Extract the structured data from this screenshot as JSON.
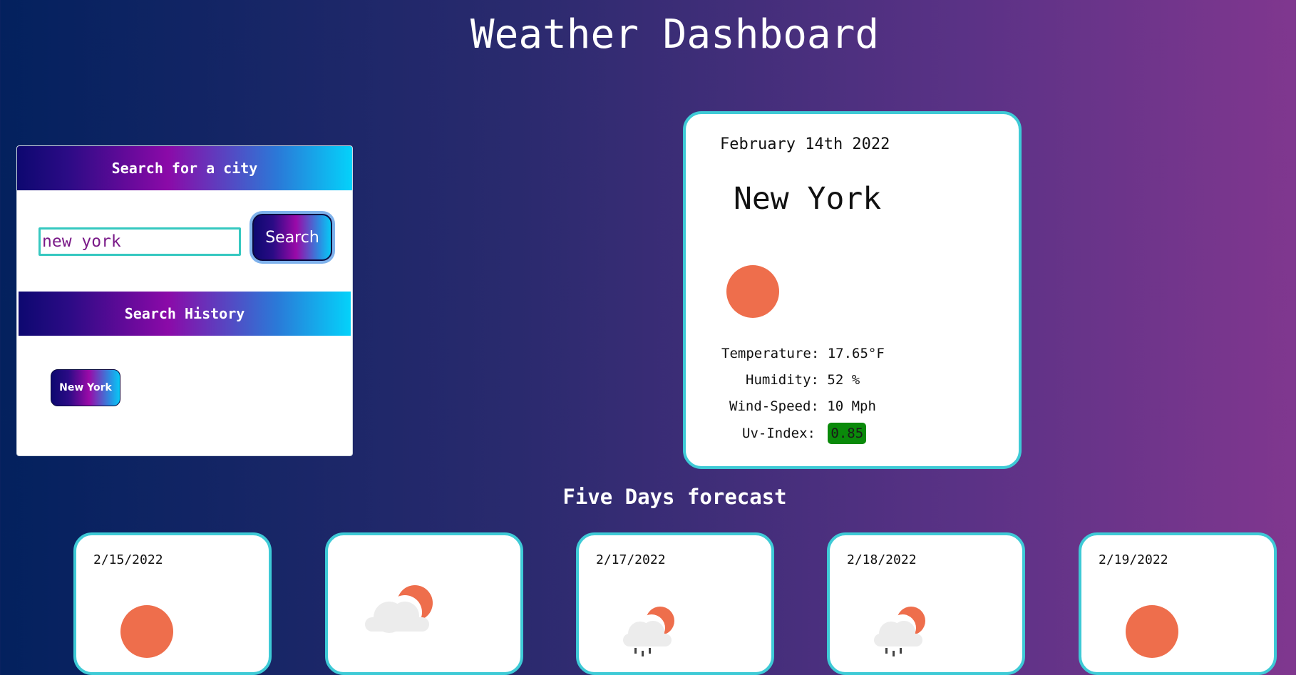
{
  "page": {
    "title": "Weather Dashboard"
  },
  "search": {
    "header": "Search for a city",
    "input_value": "new york",
    "button_label": "Search",
    "history_header": "Search History",
    "history": [
      "New York"
    ]
  },
  "current": {
    "date": "February 14th 2022",
    "city": "New York",
    "icon": "sun-icon",
    "temperature_label": "Temperature:",
    "temperature": "17.65°F",
    "humidity_label": "Humidity:",
    "humidity": "52 %",
    "wind_label": "Wind-Speed:",
    "wind": "10 Mph",
    "uv_label": "Uv-Index:",
    "uv": "0.85",
    "uv_color": "#0a8a0a"
  },
  "forecast": {
    "title": "Five Days forecast",
    "days": [
      {
        "date": "2/15/2022",
        "icon": "sun-icon"
      },
      {
        "date": "",
        "icon": "partly-cloudy-icon"
      },
      {
        "date": "2/17/2022",
        "icon": "rain-cloud-sun-icon"
      },
      {
        "date": "2/18/2022",
        "icon": "rain-cloud-sun-icon"
      },
      {
        "date": "2/19/2022",
        "icon": "sun-icon"
      }
    ]
  },
  "colors": {
    "accent": "#3ecad6",
    "sun": "#ee6e4c"
  }
}
